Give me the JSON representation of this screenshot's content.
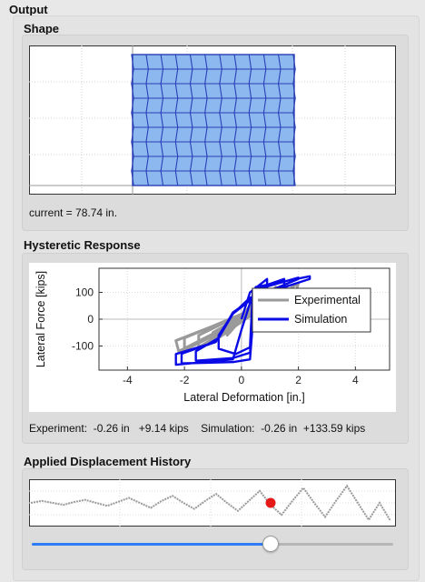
{
  "window": {
    "title": "Output"
  },
  "shape": {
    "section_title": "Shape",
    "status": "current = 78.74 in.",
    "colors": {
      "fill": "#8cb8ef",
      "edge": "#2a3fb5"
    }
  },
  "hysteretic": {
    "section_title": "Hysteretic Response",
    "readout": {
      "experiment_label": "Experiment:",
      "experiment_deformation": "-0.26 in",
      "experiment_force": "+9.14 kips",
      "simulation_label": "Simulation:",
      "simulation_deformation": "-0.26 in",
      "simulation_force": "+133.59 kips"
    }
  },
  "history": {
    "section_title": "Applied Displacement History",
    "slider_value": 0.66
  },
  "chart_data": [
    {
      "type": "line",
      "id": "hysteretic-response",
      "xlabel": "Lateral Deformation [in.]",
      "ylabel": "Lateral Force [kips]",
      "xlim": [
        -5,
        5.2
      ],
      "ylim": [
        -190,
        190
      ],
      "xticks": [
        "-4",
        "-2",
        "0",
        "2",
        "4"
      ],
      "yticks": [
        "100",
        "0",
        "-100"
      ],
      "legend_position": "top-right",
      "series": [
        {
          "name": "Experimental",
          "color": "#9a9a9a",
          "x": [
            0,
            0.4,
            0.4,
            -0.5,
            -0.5,
            0,
            0.8,
            0.8,
            -1.0,
            -1.0,
            0,
            1.2,
            1.2,
            -1.5,
            -1.5,
            0,
            1.6,
            1.6,
            -2.0,
            -2.0,
            0,
            2.0,
            1.9,
            -2.3,
            -2.2,
            0
          ],
          "y": [
            0,
            70,
            40,
            -40,
            -60,
            0,
            100,
            60,
            -50,
            -85,
            -10,
            120,
            80,
            -60,
            -105,
            -10,
            130,
            90,
            -70,
            -115,
            -10,
            135,
            95,
            -80,
            -120,
            0
          ]
        },
        {
          "name": "Simulation",
          "color": "#0a0ae6",
          "x": [
            0,
            0.3,
            0.9,
            0.9,
            0.3,
            -0.3,
            -0.8,
            -0.8,
            -0.2,
            0.3,
            0.4,
            1.5,
            1.5,
            0.3,
            -0.3,
            -0.8,
            -1.6,
            -1.6,
            -0.3,
            0.3,
            0.5,
            2.0,
            2.0,
            0.4,
            -0.3,
            -0.9,
            -2.0,
            -2.1,
            -2.1,
            -0.3,
            0.3,
            0.5,
            2.4,
            2.4,
            0.5,
            -0.3,
            -0.9,
            -2.3,
            -2.3,
            -0.3,
            0,
            0.3,
            1.0
          ],
          "y": [
            0,
            100,
            150,
            110,
            70,
            20,
            -60,
            -110,
            -130,
            -105,
            110,
            150,
            120,
            80,
            20,
            -70,
            -120,
            -155,
            -145,
            -125,
            110,
            155,
            150,
            80,
            20,
            -85,
            -125,
            -130,
            -165,
            -160,
            -150,
            120,
            160,
            150,
            85,
            25,
            -85,
            -130,
            -170,
            -150,
            -40,
            60,
            110
          ]
        }
      ]
    },
    {
      "type": "line",
      "id": "applied-displacement-history",
      "title": "",
      "xlim": [
        0,
        100
      ],
      "ylim": [
        -1,
        1
      ],
      "series": [
        {
          "name": "",
          "color": "#9a9a9a",
          "x": [
            0,
            3,
            6,
            9,
            12,
            15,
            18,
            21,
            24,
            27,
            30,
            33,
            36,
            39,
            42,
            45,
            48,
            51,
            54,
            57,
            60,
            63,
            66,
            69,
            72,
            75,
            78,
            81,
            84,
            87,
            90,
            93,
            96,
            99
          ],
          "y": [
            0,
            0.1,
            0,
            -0.1,
            0.05,
            0.15,
            0,
            -0.15,
            0.05,
            0.25,
            0,
            -0.25,
            0.1,
            0.35,
            0,
            -0.3,
            0.1,
            0.45,
            0,
            -0.4,
            0.1,
            0.6,
            -0.1,
            -0.6,
            0.1,
            0.75,
            0,
            -0.7,
            0.1,
            0.85,
            0,
            -0.85,
            0,
            -0.9
          ]
        }
      ],
      "current_point": {
        "x": 66,
        "y": 0.0,
        "color": "#e61919"
      }
    }
  ]
}
